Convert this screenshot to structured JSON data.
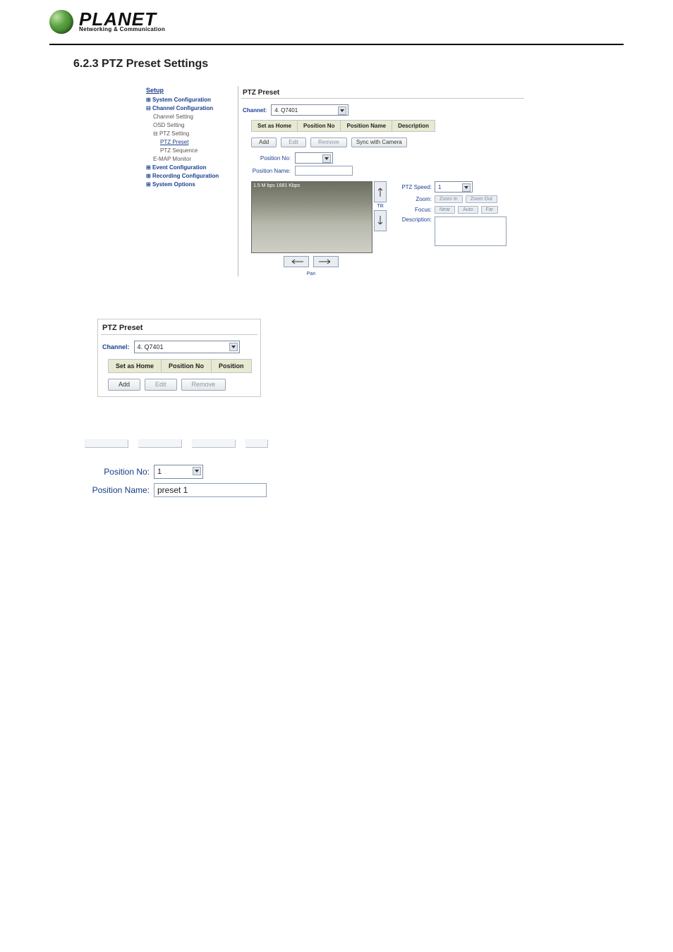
{
  "brand": {
    "name": "PLANET",
    "tagline": "Networking & Communication"
  },
  "section_heading": "6.2.3 PTZ Preset Settings",
  "sidebar": {
    "title": "Setup",
    "items": [
      {
        "label": "System Configuration"
      },
      {
        "label": "Channel Configuration"
      },
      {
        "label": "Event Configuration"
      },
      {
        "label": "Recording Configuration"
      },
      {
        "label": "System Options"
      }
    ],
    "channel_children": [
      "Channel Setting",
      "OSD Setting",
      "PTZ Setting",
      "E-MAP Monitor"
    ],
    "ptz_children": [
      "PTZ Preset",
      "PTZ Sequence"
    ]
  },
  "panel": {
    "title": "PTZ Preset",
    "channel_label": "Channel:",
    "channel_value": "4. Q7401",
    "columns": {
      "set_as_home": "Set as Home",
      "position_no": "Position No",
      "position_name": "Position Name",
      "description": "Description"
    },
    "buttons": {
      "add": "Add",
      "edit": "Edit",
      "remove": "Remove",
      "sync": "Sync with Camera"
    },
    "form": {
      "position_no_label": "Position No:",
      "position_name_label": "Position Name:"
    },
    "camera_overlay": "1.5 M bps   1681 Kbps",
    "tilt_label": "Tilt",
    "pan_label": "Pan",
    "controls": {
      "ptz_speed_label": "PTZ Speed:",
      "ptz_speed_value": "1",
      "zoom_label": "Zoom:",
      "zoom_in": "Zoom In",
      "zoom_out": "Zoom Out",
      "focus_label": "Focus:",
      "focus_near": "Near",
      "focus_auto": "Auto",
      "focus_far": "Far",
      "description_label": "Description:"
    }
  },
  "crop2": {
    "title": "PTZ Preset",
    "channel_label": "Channel:",
    "channel_value": "4. Q7401",
    "cols": {
      "c1": "Set as Home",
      "c2": "Position No",
      "c3": "Position"
    },
    "btn_add": "Add",
    "btn_edit": "Edit",
    "btn_remove": "Remove"
  },
  "crop3": {
    "position_no_label": "Position No:",
    "position_no_value": "1",
    "position_name_label": "Position Name:",
    "position_name_value": "preset 1"
  }
}
